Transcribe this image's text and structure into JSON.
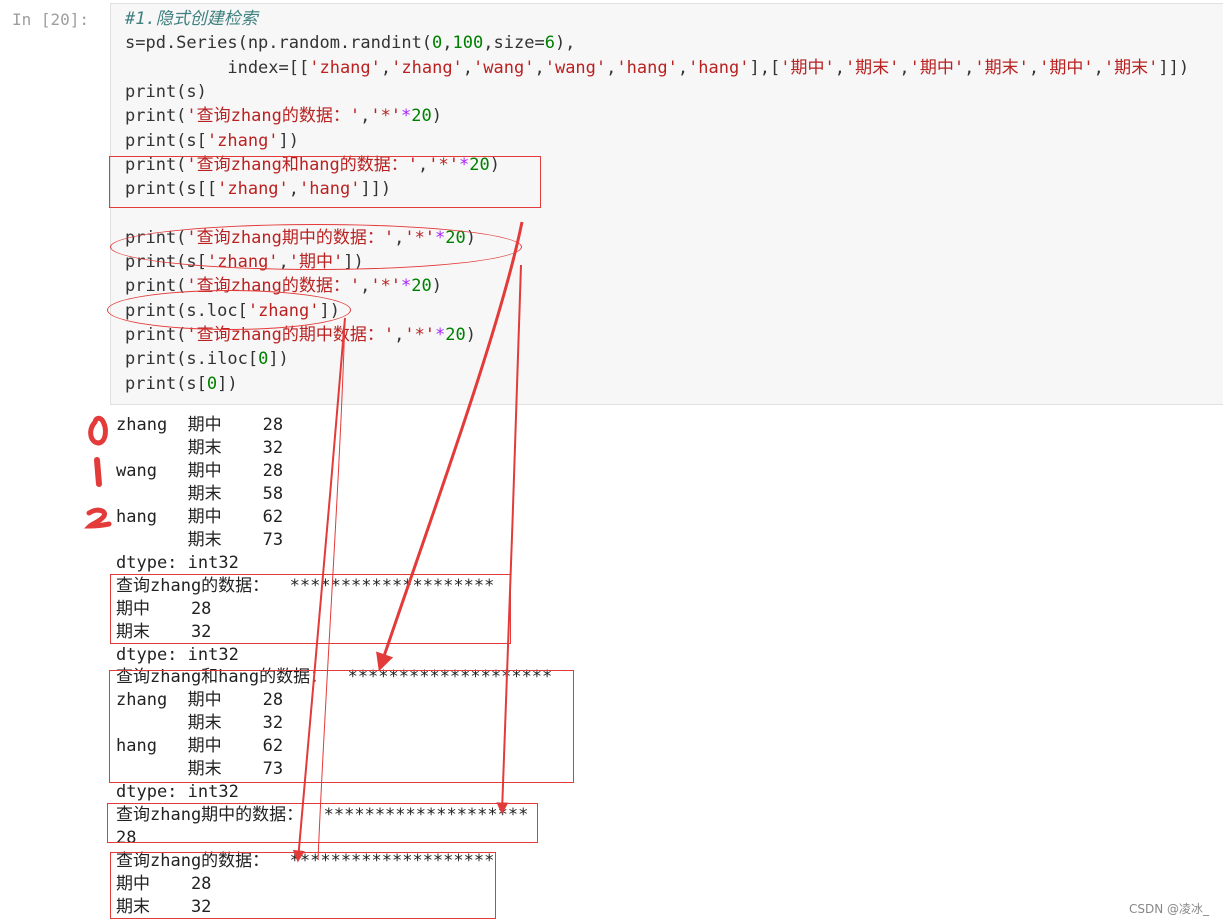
{
  "cell": {
    "prompt": "In  [20]:",
    "lines": [
      [
        {
          "t": "#1.隐式创建检索",
          "c": "comment"
        }
      ],
      [
        {
          "t": "s=pd.Series(np.random.randint("
        },
        {
          "t": "0",
          "c": "num"
        },
        {
          "t": ","
        },
        {
          "t": "100",
          "c": "num"
        },
        {
          "t": ",size="
        },
        {
          "t": "6",
          "c": "num"
        },
        {
          "t": "),"
        }
      ],
      [
        {
          "t": "          index=[["
        },
        {
          "t": "'zhang'",
          "c": "str"
        },
        {
          "t": ","
        },
        {
          "t": "'zhang'",
          "c": "str"
        },
        {
          "t": ","
        },
        {
          "t": "'wang'",
          "c": "str"
        },
        {
          "t": ","
        },
        {
          "t": "'wang'",
          "c": "str"
        },
        {
          "t": ","
        },
        {
          "t": "'hang'",
          "c": "str"
        },
        {
          "t": ","
        },
        {
          "t": "'hang'",
          "c": "str"
        },
        {
          "t": "],["
        },
        {
          "t": "'期中'",
          "c": "str"
        },
        {
          "t": ","
        },
        {
          "t": "'期末'",
          "c": "str"
        },
        {
          "t": ","
        },
        {
          "t": "'期中'",
          "c": "str"
        },
        {
          "t": ","
        },
        {
          "t": "'期末'",
          "c": "str"
        },
        {
          "t": ","
        },
        {
          "t": "'期中'",
          "c": "str"
        },
        {
          "t": ","
        },
        {
          "t": "'期末'",
          "c": "str"
        },
        {
          "t": "]])"
        }
      ],
      [
        {
          "t": "print(s)"
        }
      ],
      [
        {
          "t": "print("
        },
        {
          "t": "'查询zhang的数据：'",
          "c": "str"
        },
        {
          "t": ","
        },
        {
          "t": "'*'",
          "c": "str"
        },
        {
          "t": "*",
          "c": "op"
        },
        {
          "t": "20",
          "c": "num"
        },
        {
          "t": ")"
        }
      ],
      [
        {
          "t": "print(s["
        },
        {
          "t": "'zhang'",
          "c": "str"
        },
        {
          "t": "])"
        }
      ],
      [
        {
          "t": "print("
        },
        {
          "t": "'查询zhang和hang的数据：'",
          "c": "str"
        },
        {
          "t": ","
        },
        {
          "t": "'*'",
          "c": "str"
        },
        {
          "t": "*",
          "c": "op"
        },
        {
          "t": "20",
          "c": "num"
        },
        {
          "t": ")"
        }
      ],
      [
        {
          "t": "print(s[["
        },
        {
          "t": "'zhang'",
          "c": "str"
        },
        {
          "t": ","
        },
        {
          "t": "'hang'",
          "c": "str"
        },
        {
          "t": "]])"
        }
      ],
      [],
      [
        {
          "t": "print("
        },
        {
          "t": "'查询zhang期中的数据：'",
          "c": "str"
        },
        {
          "t": ","
        },
        {
          "t": "'*'",
          "c": "str"
        },
        {
          "t": "*",
          "c": "op"
        },
        {
          "t": "20",
          "c": "num"
        },
        {
          "t": ")"
        }
      ],
      [
        {
          "t": "print(s["
        },
        {
          "t": "'zhang'",
          "c": "str"
        },
        {
          "t": ","
        },
        {
          "t": "'期中'",
          "c": "str"
        },
        {
          "t": "])"
        }
      ],
      [
        {
          "t": "print("
        },
        {
          "t": "'查询zhang的数据：'",
          "c": "str"
        },
        {
          "t": ","
        },
        {
          "t": "'*'",
          "c": "str"
        },
        {
          "t": "*",
          "c": "op"
        },
        {
          "t": "20",
          "c": "num"
        },
        {
          "t": ")"
        }
      ],
      [
        {
          "t": "print(s.loc["
        },
        {
          "t": "'zhang'",
          "c": "str"
        },
        {
          "t": "])"
        }
      ],
      [
        {
          "t": "print("
        },
        {
          "t": "'查询zhang的期中数据：'",
          "c": "str"
        },
        {
          "t": ","
        },
        {
          "t": "'*'",
          "c": "str"
        },
        {
          "t": "*",
          "c": "op"
        },
        {
          "t": "20",
          "c": "num"
        },
        {
          "t": ")"
        }
      ],
      [
        {
          "t": "print(s.iloc["
        },
        {
          "t": "0",
          "c": "num"
        },
        {
          "t": "])"
        }
      ],
      [
        {
          "t": "print(s["
        },
        {
          "t": "0",
          "c": "num"
        },
        {
          "t": "])"
        }
      ]
    ]
  },
  "output": {
    "lines": [
      "zhang  期中    28",
      "       期末    32",
      "wang   期中    28",
      "       期末    58",
      "hang   期中    62",
      "       期末    73",
      "dtype: int32",
      "查询zhang的数据：  ********************",
      "期中    28",
      "期末    32",
      "dtype: int32",
      "查询zhang和hang的数据：  ********************",
      "zhang  期中    28",
      "       期末    32",
      "hang   期中    62",
      "       期末    73",
      "dtype: int32",
      "查询zhang期中的数据：  ********************",
      "28",
      "查询zhang的数据：  ********************",
      "期中    28",
      "期末    32"
    ]
  },
  "annotation_color": "#e33a3a",
  "watermark": "CSDN @凌冰_"
}
